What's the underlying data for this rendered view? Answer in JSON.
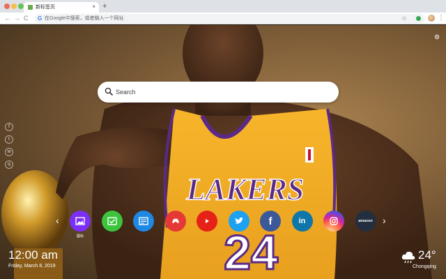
{
  "browser": {
    "tab_title": "新标签页",
    "tab_close": "×",
    "new_tab": "+",
    "address_placeholder": "在Google中搜索，或者输入一个网址",
    "nav": {
      "back": "←",
      "forward": "→",
      "reload": "C"
    },
    "menu": "⋮"
  },
  "wallpaper": {
    "jersey_team": "LAKERS",
    "jersey_number": "24"
  },
  "search": {
    "placeholder": "Search"
  },
  "side_social": [
    "f",
    "t",
    "w",
    "q"
  ],
  "dock": {
    "prev": "‹",
    "next": "›",
    "shortcuts": [
      {
        "name": "image",
        "label": "图标",
        "color": "#7b2ff7",
        "icon": "image-icon"
      },
      {
        "name": "checklist",
        "label": "",
        "color": "#3cc43c",
        "icon": "check-icon"
      },
      {
        "name": "notes",
        "label": "",
        "color": "#1e88e5",
        "icon": "note-icon"
      },
      {
        "name": "game",
        "label": "",
        "color": "#e53935",
        "icon": "gamepad-icon"
      },
      {
        "name": "youtube",
        "label": "",
        "color": "#e62117",
        "icon": "youtube-icon"
      },
      {
        "name": "twitter",
        "label": "",
        "color": "#1da1f2",
        "icon": "twitter-icon"
      },
      {
        "name": "facebook",
        "label": "",
        "color": "#3b5998",
        "icon": "facebook-icon"
      },
      {
        "name": "linkedin",
        "label": "",
        "color": "#0e76a8",
        "icon": "linkedin-icon"
      },
      {
        "name": "instagram",
        "label": "",
        "color": "#c13584",
        "icon": "instagram-icon"
      },
      {
        "name": "amazon",
        "label": "amazon",
        "color": "#232f3e",
        "icon": "amazon-icon"
      }
    ]
  },
  "clock": {
    "time": "12:00 am",
    "date": "Friday, March 8, 2019"
  },
  "weather": {
    "temp": "24°",
    "city": "Chongqing",
    "icon": "cloud-rain-icon"
  }
}
